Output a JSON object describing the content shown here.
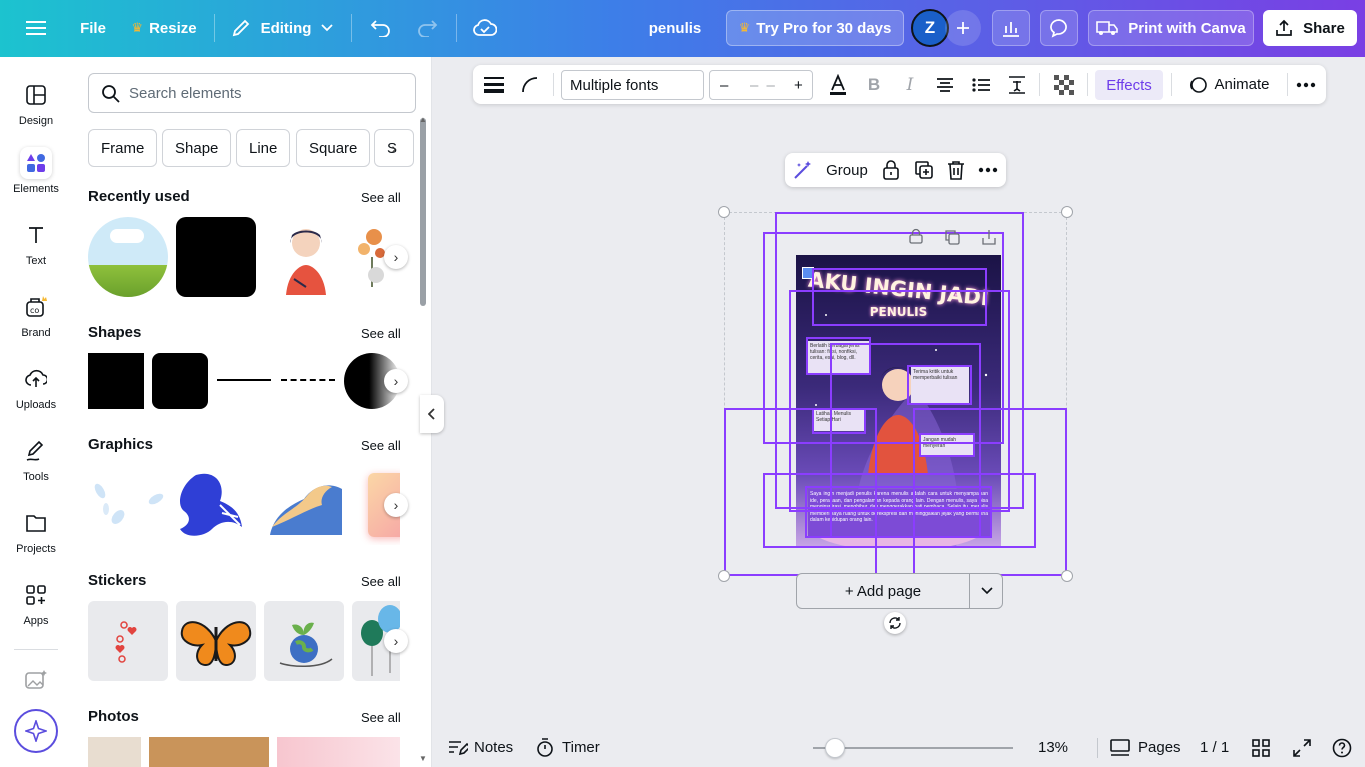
{
  "topbar": {
    "file": "File",
    "resize": "Resize",
    "editing": "Editing",
    "doc_title": "penulis",
    "try_pro": "Try Pro for 30 days",
    "avatar_letter": "Z",
    "print": "Print with Canva",
    "share": "Share"
  },
  "rail": {
    "design": "Design",
    "elements": "Elements",
    "text": "Text",
    "brand": "Brand",
    "uploads": "Uploads",
    "tools": "Tools",
    "projects": "Projects",
    "apps": "Apps"
  },
  "panel": {
    "search_placeholder": "Search elements",
    "chips": [
      "Frame",
      "Shape",
      "Line",
      "Square",
      "S"
    ],
    "recently_used": "Recently used",
    "shapes": "Shapes",
    "graphics": "Graphics",
    "stickers": "Stickers",
    "photos": "Photos",
    "see_all": "See all"
  },
  "toolbar": {
    "font": "Multiple fonts",
    "minus": "–",
    "size": "– –",
    "plus": "+",
    "effects": "Effects",
    "animate": "Animate"
  },
  "group_bar": {
    "group": "Group"
  },
  "design": {
    "title_line1": "AKU INGIN JADI",
    "title_line2": "PENULIS",
    "box1": "Berlatih berbagai jenis tulisan: fiksi, nonfiksi, cerita, esai, blog, dll.",
    "box2": "Terima kritik untuk memperbaiki tulisan",
    "box3": "Latihan Menulis Setiap Hari",
    "box4": "Jangan mudah menyerah",
    "paragraph": "Saya ingin menjadi penulis karena menulis adalah cara untuk menyampaikan ide, perasaan, dan pengalaman kepada orang lain. Dengan menulis, saya bisa menginspirasi, menghibur, dan menggerakkan hati pembaca. Selain itu, menulis memberi saya ruang untuk berekspresi dan meninggalkan jejak yang bermakna dalam kehidupan orang lain."
  },
  "canvas": {
    "add_page": "+ Add page"
  },
  "bottom": {
    "notes": "Notes",
    "timer": "Timer",
    "zoom": "13%",
    "pages": "Pages",
    "page_count": "1 / 1"
  },
  "colors": {
    "accent": "#8b3dff",
    "pro_star": "#f5b833",
    "selected_rail": "#e8e2fb"
  }
}
